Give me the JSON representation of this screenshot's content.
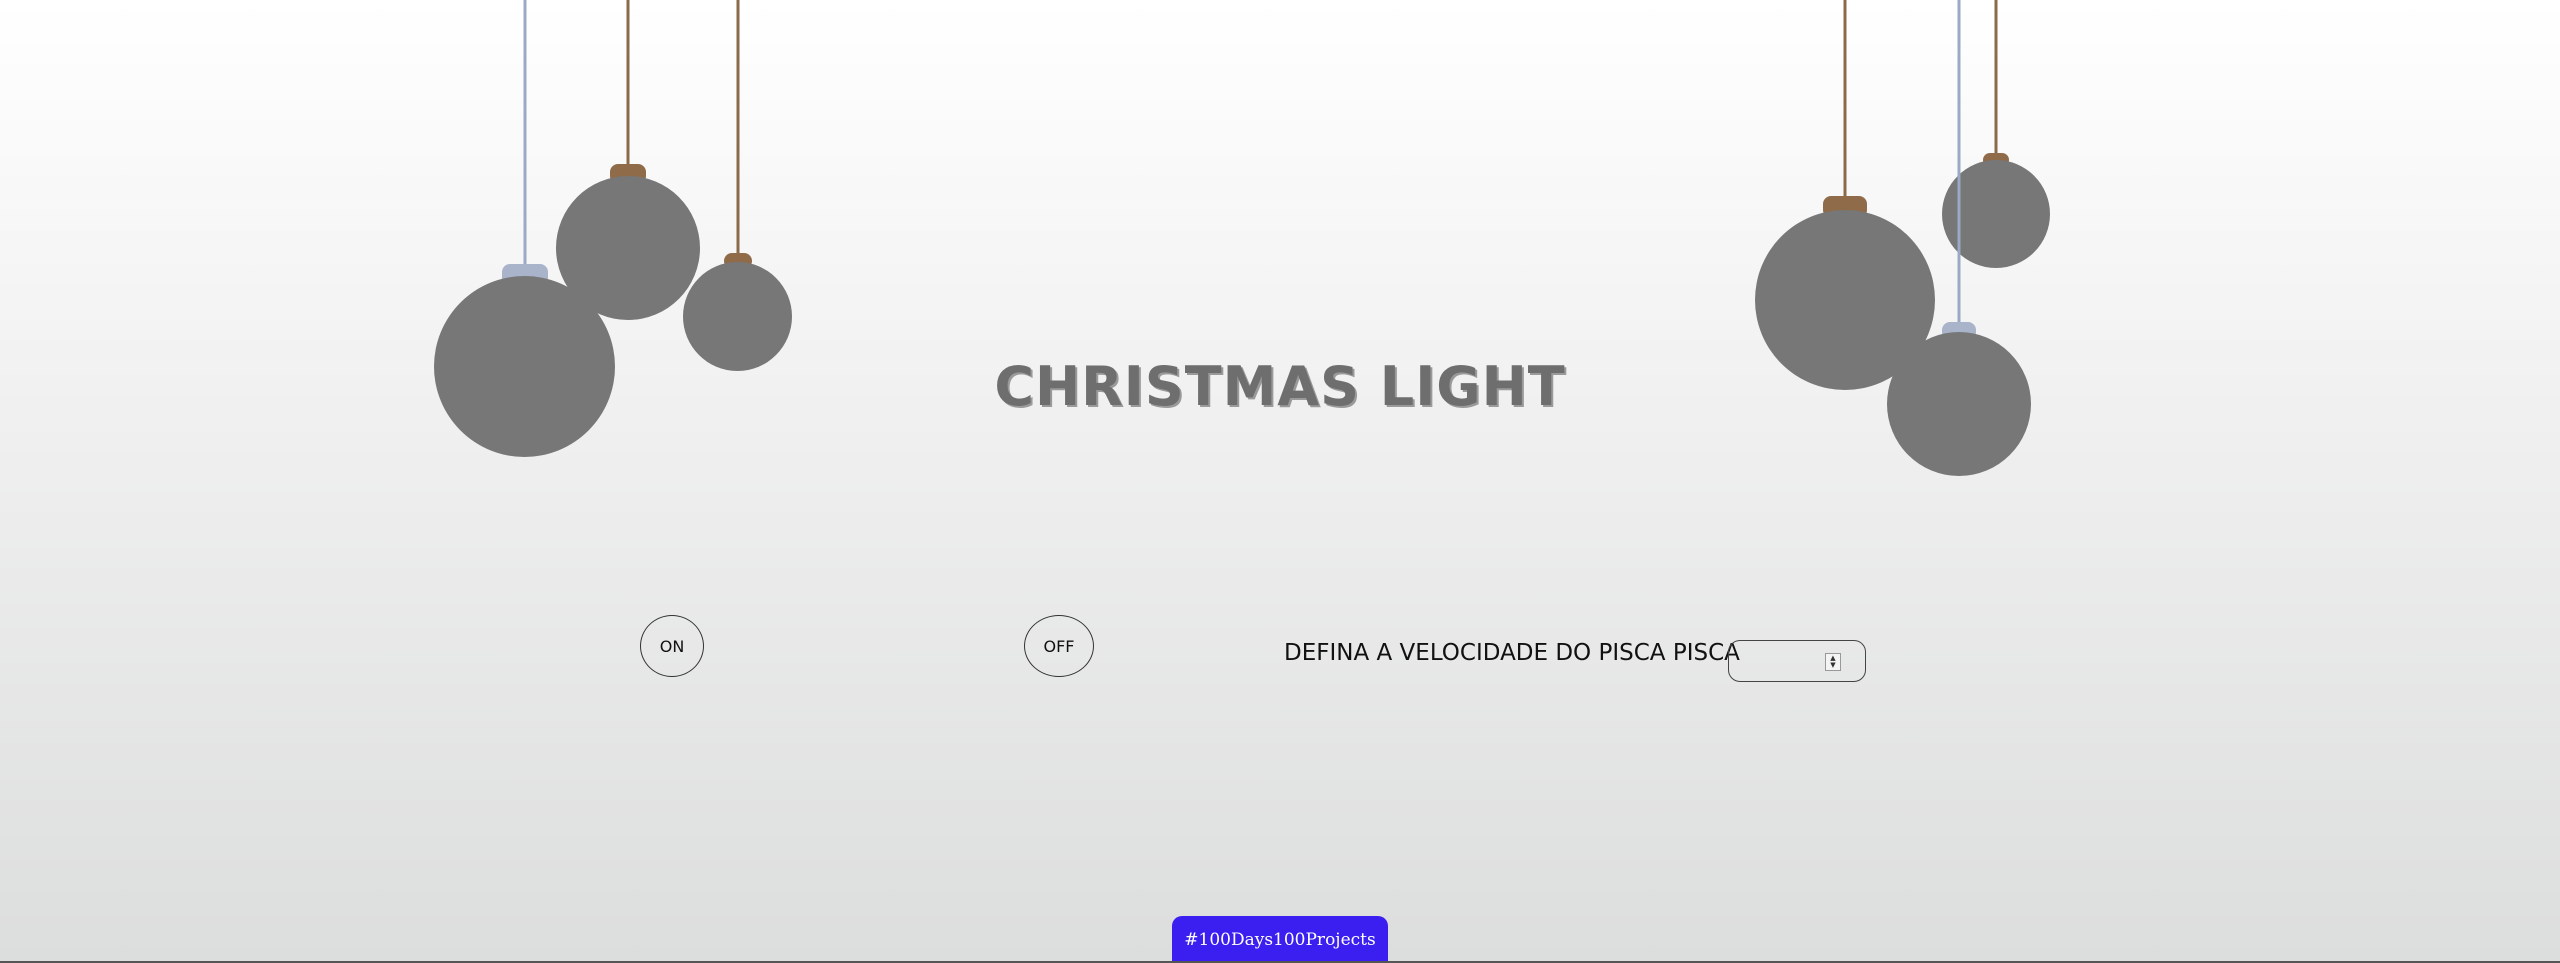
{
  "page": {
    "title": "CHRISTMAS LIGHT"
  },
  "colors": {
    "ball": "#767776",
    "string_brown": "#8b6a49",
    "string_blue": "#9aaac4",
    "cap_brown": "#8f6b4a",
    "cap_blue": "#a9b3c9",
    "badge": "#3b1ff0"
  },
  "controls": {
    "on_label": "ON",
    "off_label": "OFF",
    "speed_label": "DEFINA A VELOCIDADE DO PISCA PISCA",
    "speed_value": "",
    "speed_placeholder": ""
  },
  "footer": {
    "badge_label": "#100Days100Projects"
  },
  "icons": {
    "spinner": "number-spinner-icon"
  }
}
